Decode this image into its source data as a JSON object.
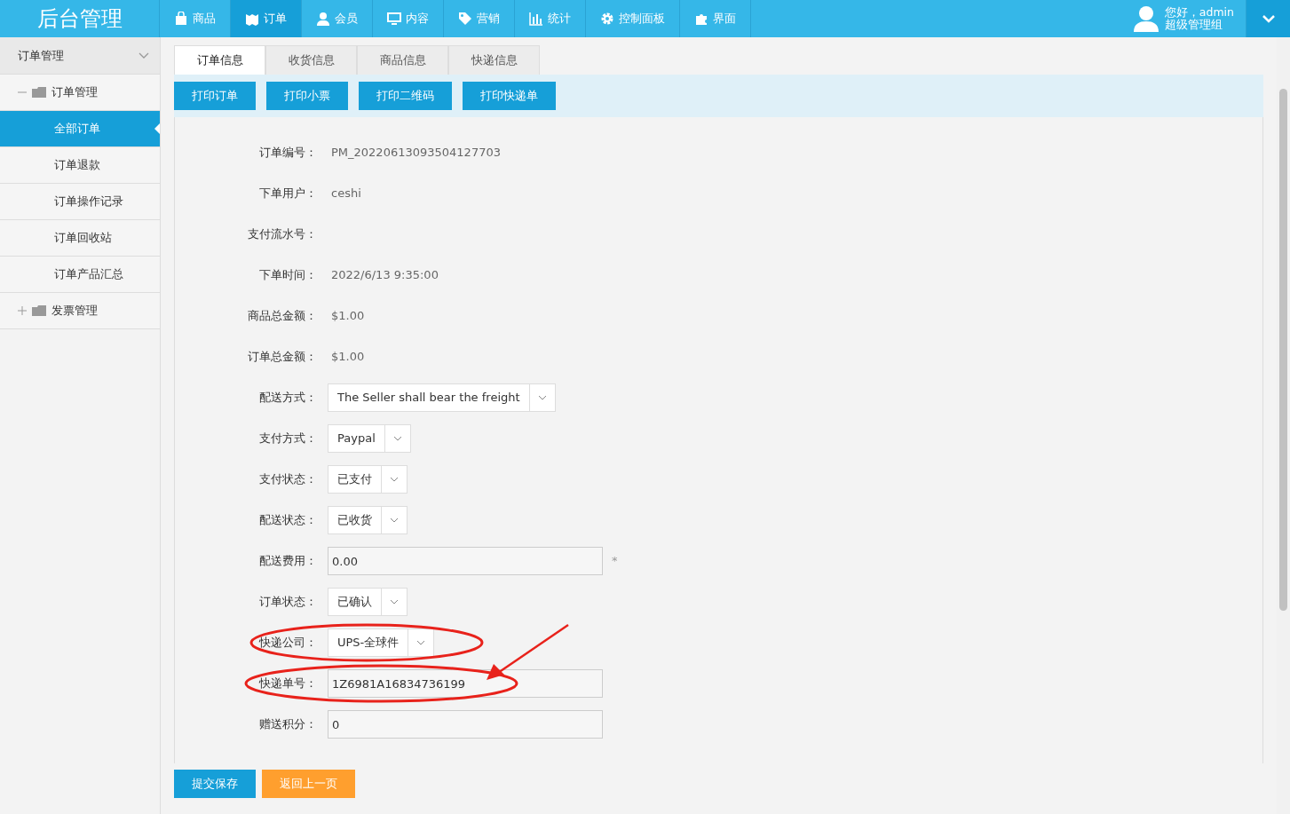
{
  "app_title": "后台管理",
  "nav": [
    {
      "label": "商品",
      "selected": false
    },
    {
      "label": "订单",
      "selected": true
    },
    {
      "label": "会员",
      "selected": false
    },
    {
      "label": "内容",
      "selected": false
    },
    {
      "label": "营销",
      "selected": false
    },
    {
      "label": "统计",
      "selected": false
    },
    {
      "label": "控制面板",
      "selected": false
    },
    {
      "label": "界面",
      "selected": false
    }
  ],
  "user": {
    "greeting": "您好，admin",
    "role": "超级管理组"
  },
  "sidebar": {
    "title": "订单管理",
    "items": [
      {
        "label": "订单管理",
        "expanded": true,
        "children": [
          {
            "label": "全部订单",
            "selected": true
          },
          {
            "label": "订单退款",
            "selected": false
          },
          {
            "label": "订单操作记录",
            "selected": false
          },
          {
            "label": "订单回收站",
            "selected": false
          },
          {
            "label": "订单产品汇总",
            "selected": false
          }
        ]
      },
      {
        "label": "发票管理",
        "expanded": false
      }
    ]
  },
  "tabs": [
    {
      "label": "订单信息",
      "selected": true
    },
    {
      "label": "收货信息",
      "selected": false
    },
    {
      "label": "商品信息",
      "selected": false
    },
    {
      "label": "快递信息",
      "selected": false
    }
  ],
  "toolbar": [
    "打印订单",
    "打印小票",
    "打印二维码",
    "打印快递单"
  ],
  "form": [
    {
      "kind": "text",
      "label": "订单编号：",
      "value": "PM_20220613093504127703"
    },
    {
      "kind": "text",
      "label": "下单用户：",
      "value": "ceshi"
    },
    {
      "kind": "text",
      "label": "支付流水号："
    },
    {
      "kind": "text",
      "label": "下单时间：",
      "value": "2022/6/13 9:35:00"
    },
    {
      "kind": "text",
      "label": "商品总金额：",
      "value": "$1.00"
    },
    {
      "kind": "text",
      "label": "订单总金额：",
      "value": "$1.00"
    },
    {
      "kind": "select",
      "label": "配送方式：",
      "value": "The Seller shall bear the freight"
    },
    {
      "kind": "select",
      "label": "支付方式：",
      "value": "Paypal"
    },
    {
      "kind": "select",
      "label": "支付状态：",
      "value": "已支付"
    },
    {
      "kind": "select",
      "label": "配送状态：",
      "value": "已收货"
    },
    {
      "kind": "input",
      "label": "配送费用：",
      "value": "0.00",
      "required_mark": "*"
    },
    {
      "kind": "select",
      "label": "订单状态：",
      "value": "已确认"
    },
    {
      "kind": "select",
      "label": "快递公司：",
      "value": "UPS-全球件",
      "circled": true
    },
    {
      "kind": "input",
      "label": "快递单号：",
      "value": "1Z6981A16834736199",
      "circled": true,
      "arrow": true
    },
    {
      "kind": "input",
      "label": "赠送积分：",
      "value": "0"
    }
  ],
  "actions": [
    {
      "label": "提交保存",
      "kind": "primary"
    },
    {
      "label": "返回上一页",
      "kind": "warning"
    }
  ]
}
